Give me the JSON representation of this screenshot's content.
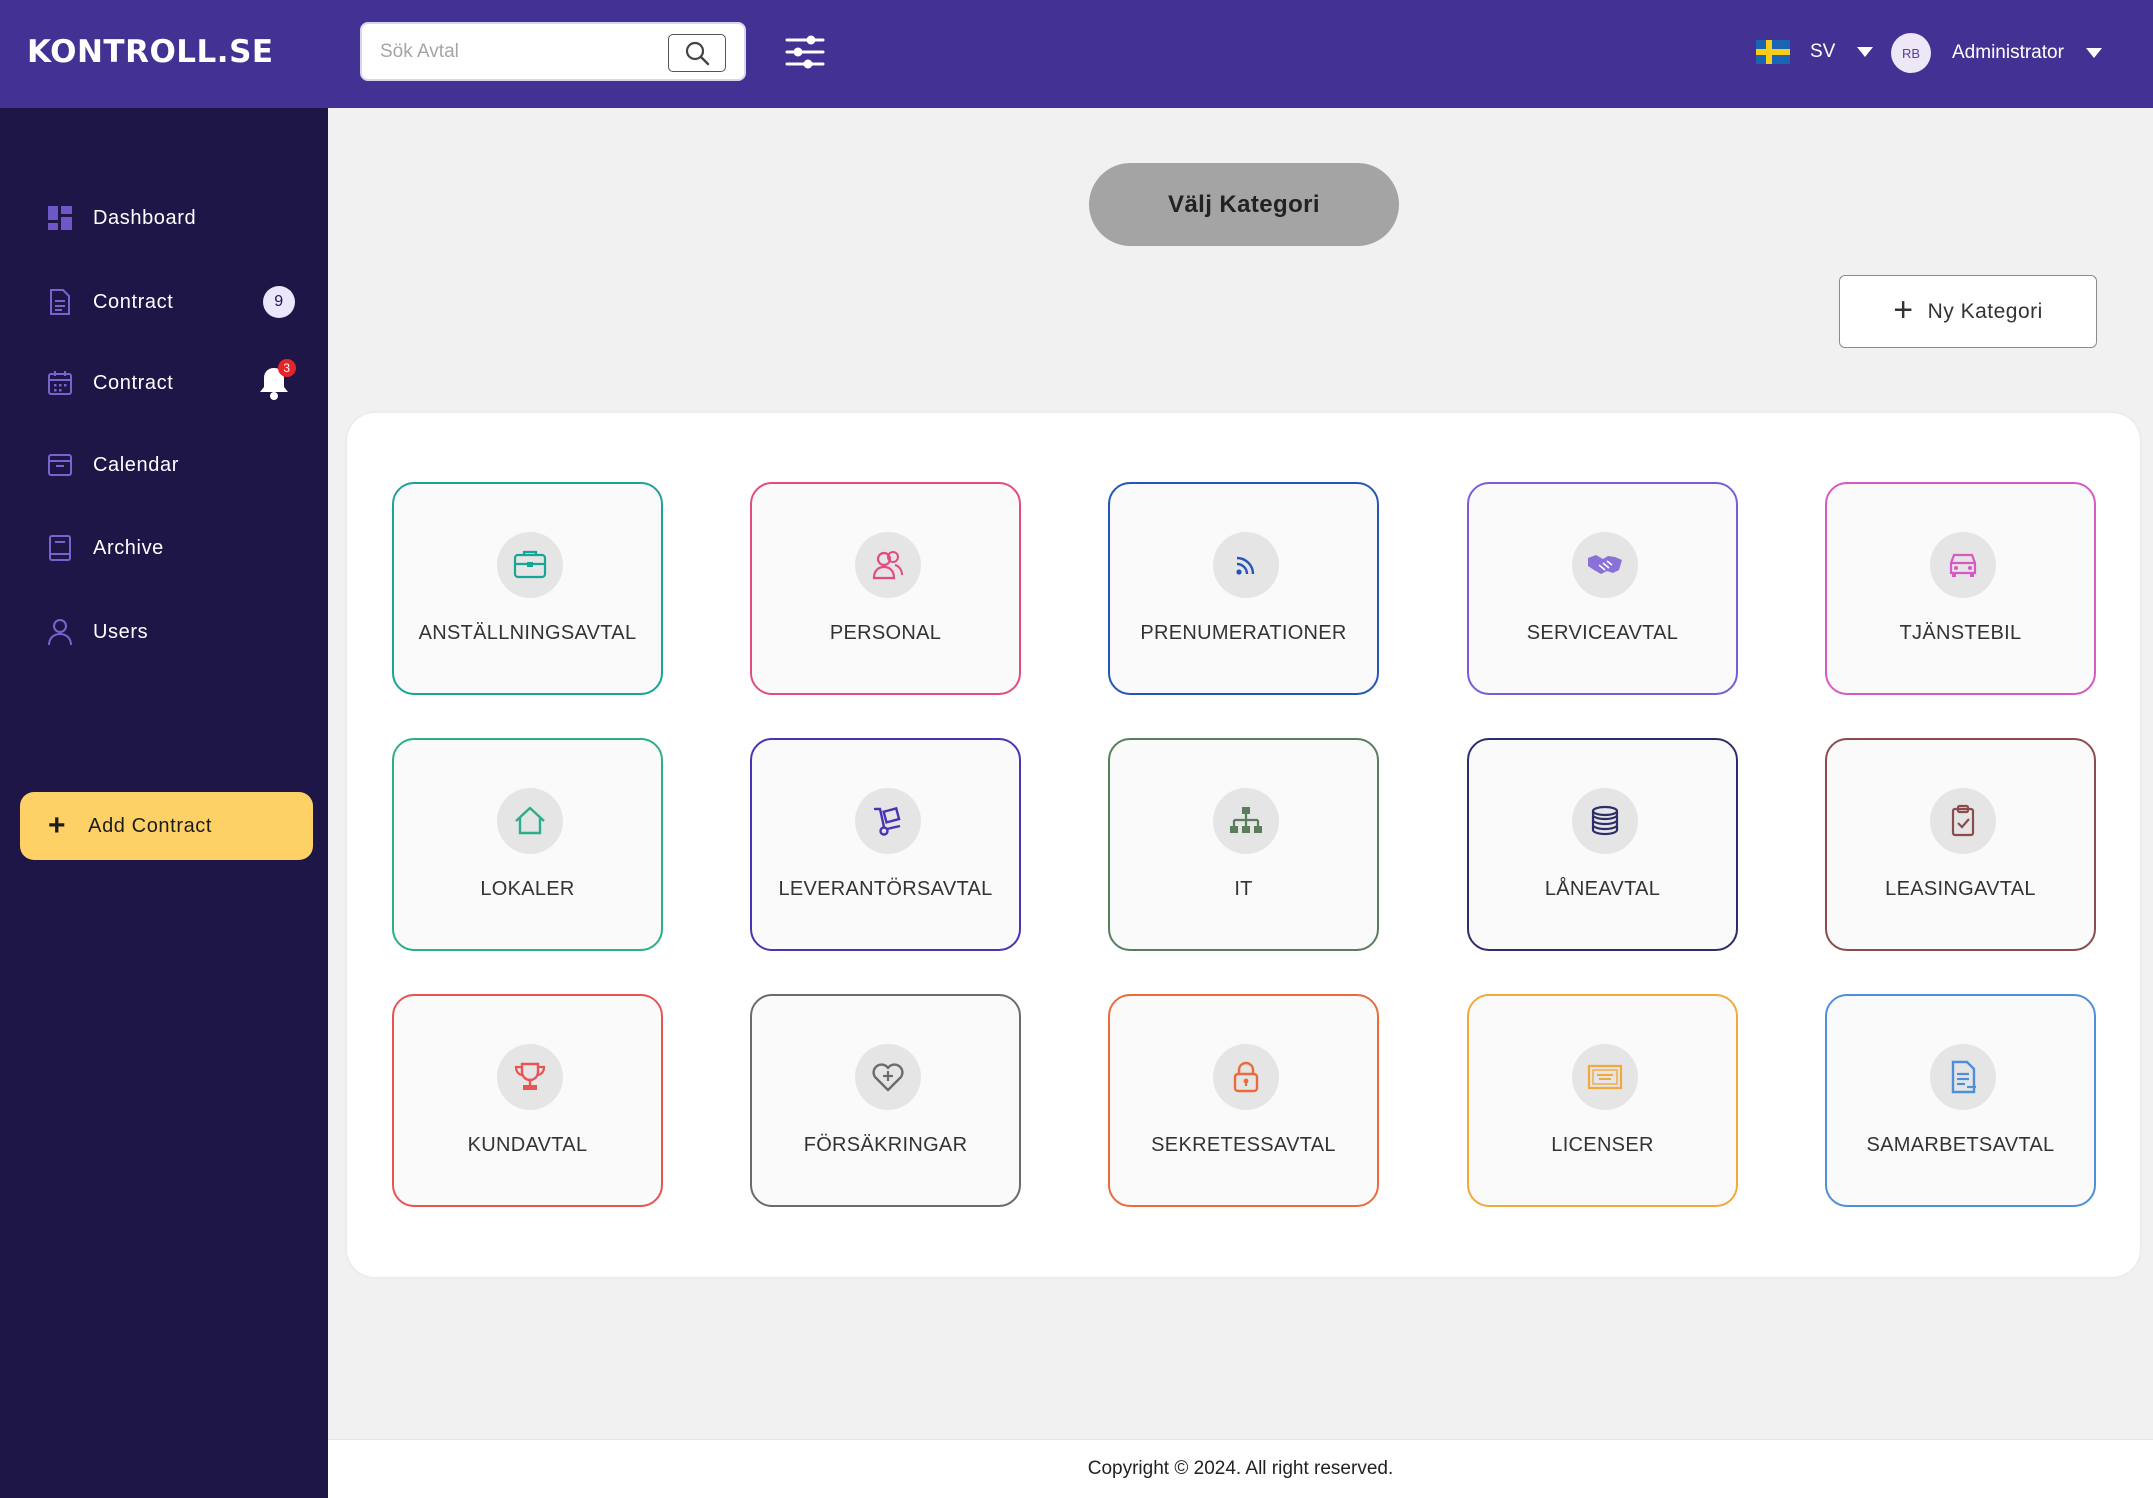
{
  "header": {
    "brand": "KONTROLL.SE",
    "search_placeholder": "Sök Avtal",
    "language": "SV",
    "avatar_initials": "RB",
    "user_name": "Administrator"
  },
  "sidebar": {
    "items": [
      {
        "label": "Dashboard",
        "icon": "dashboard-icon"
      },
      {
        "label": "Contract",
        "icon": "document-icon",
        "badge": "9"
      },
      {
        "label": "Contract",
        "icon": "calendar-grid-icon",
        "notification_count": "3"
      },
      {
        "label": "Calendar",
        "icon": "inbox-icon"
      },
      {
        "label": "Archive",
        "icon": "book-icon"
      },
      {
        "label": "Users",
        "icon": "user-icon"
      }
    ],
    "add_button": "Add Contract"
  },
  "main": {
    "select_category": "Välj Kategori",
    "new_category": "Ny Kategori",
    "categories": [
      {
        "label": "ANSTÄLLNINGSAVTAL",
        "icon": "briefcase-icon",
        "color": "#18a595"
      },
      {
        "label": "PERSONAL",
        "icon": "people-icon",
        "color": "#e44b82"
      },
      {
        "label": "PRENUMERATIONER",
        "icon": "rss-icon",
        "color": "#2356b8"
      },
      {
        "label": "SERVICEAVTAL",
        "icon": "handshake-icon",
        "color": "#7a5dd6"
      },
      {
        "label": "TJÄNSTEBIL",
        "icon": "car-icon",
        "color": "#d659c4"
      },
      {
        "label": "LOKALER",
        "icon": "house-icon",
        "color": "#2bae8a"
      },
      {
        "label": "LEVERANTÖRSAVTAL",
        "icon": "hand-truck-icon",
        "color": "#4e32b5"
      },
      {
        "label": "IT",
        "icon": "network-icon",
        "color": "#5a7d5c"
      },
      {
        "label": "LÅNEAVTAL",
        "icon": "coins-icon",
        "color": "#2d2d6b"
      },
      {
        "label": "LEASINGAVTAL",
        "icon": "clipboard-check-icon",
        "color": "#8a4c4c"
      },
      {
        "label": "KUNDAVTAL",
        "icon": "trophy-icon",
        "color": "#e85454"
      },
      {
        "label": "FÖRSÄKRINGAR",
        "icon": "heart-plus-icon",
        "color": "#6b6b6b"
      },
      {
        "label": "SEKRETESSAVTAL",
        "icon": "lock-icon",
        "color": "#ea6b3c"
      },
      {
        "label": "LICENSER",
        "icon": "certificate-icon",
        "color": "#f2a93b"
      },
      {
        "label": "SAMARBETSAVTAL",
        "icon": "file-text-icon",
        "color": "#4f8fd8"
      }
    ]
  },
  "footer": {
    "copyright": "Copyright © 2024. All right reserved."
  }
}
